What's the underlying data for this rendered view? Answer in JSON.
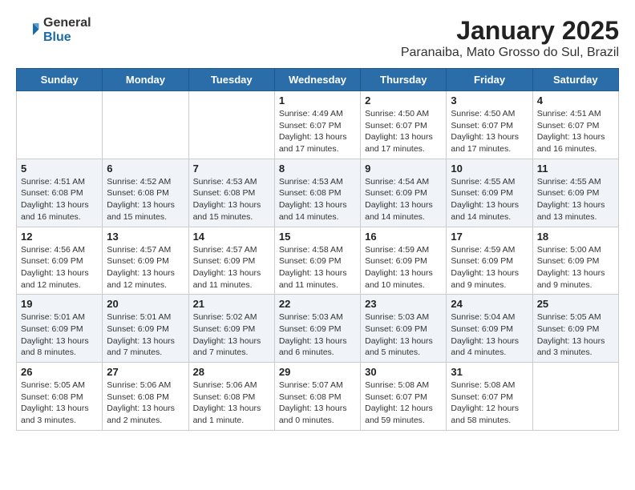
{
  "header": {
    "logo_general": "General",
    "logo_blue": "Blue",
    "title": "January 2025",
    "location": "Paranaiba, Mato Grosso do Sul, Brazil"
  },
  "days_of_week": [
    "Sunday",
    "Monday",
    "Tuesday",
    "Wednesday",
    "Thursday",
    "Friday",
    "Saturday"
  ],
  "weeks": [
    [
      {
        "day": "",
        "info": ""
      },
      {
        "day": "",
        "info": ""
      },
      {
        "day": "",
        "info": ""
      },
      {
        "day": "1",
        "info": "Sunrise: 4:49 AM\nSunset: 6:07 PM\nDaylight: 13 hours\nand 17 minutes."
      },
      {
        "day": "2",
        "info": "Sunrise: 4:50 AM\nSunset: 6:07 PM\nDaylight: 13 hours\nand 17 minutes."
      },
      {
        "day": "3",
        "info": "Sunrise: 4:50 AM\nSunset: 6:07 PM\nDaylight: 13 hours\nand 17 minutes."
      },
      {
        "day": "4",
        "info": "Sunrise: 4:51 AM\nSunset: 6:07 PM\nDaylight: 13 hours\nand 16 minutes."
      }
    ],
    [
      {
        "day": "5",
        "info": "Sunrise: 4:51 AM\nSunset: 6:08 PM\nDaylight: 13 hours\nand 16 minutes."
      },
      {
        "day": "6",
        "info": "Sunrise: 4:52 AM\nSunset: 6:08 PM\nDaylight: 13 hours\nand 15 minutes."
      },
      {
        "day": "7",
        "info": "Sunrise: 4:53 AM\nSunset: 6:08 PM\nDaylight: 13 hours\nand 15 minutes."
      },
      {
        "day": "8",
        "info": "Sunrise: 4:53 AM\nSunset: 6:08 PM\nDaylight: 13 hours\nand 14 minutes."
      },
      {
        "day": "9",
        "info": "Sunrise: 4:54 AM\nSunset: 6:09 PM\nDaylight: 13 hours\nand 14 minutes."
      },
      {
        "day": "10",
        "info": "Sunrise: 4:55 AM\nSunset: 6:09 PM\nDaylight: 13 hours\nand 14 minutes."
      },
      {
        "day": "11",
        "info": "Sunrise: 4:55 AM\nSunset: 6:09 PM\nDaylight: 13 hours\nand 13 minutes."
      }
    ],
    [
      {
        "day": "12",
        "info": "Sunrise: 4:56 AM\nSunset: 6:09 PM\nDaylight: 13 hours\nand 12 minutes."
      },
      {
        "day": "13",
        "info": "Sunrise: 4:57 AM\nSunset: 6:09 PM\nDaylight: 13 hours\nand 12 minutes."
      },
      {
        "day": "14",
        "info": "Sunrise: 4:57 AM\nSunset: 6:09 PM\nDaylight: 13 hours\nand 11 minutes."
      },
      {
        "day": "15",
        "info": "Sunrise: 4:58 AM\nSunset: 6:09 PM\nDaylight: 13 hours\nand 11 minutes."
      },
      {
        "day": "16",
        "info": "Sunrise: 4:59 AM\nSunset: 6:09 PM\nDaylight: 13 hours\nand 10 minutes."
      },
      {
        "day": "17",
        "info": "Sunrise: 4:59 AM\nSunset: 6:09 PM\nDaylight: 13 hours\nand 9 minutes."
      },
      {
        "day": "18",
        "info": "Sunrise: 5:00 AM\nSunset: 6:09 PM\nDaylight: 13 hours\nand 9 minutes."
      }
    ],
    [
      {
        "day": "19",
        "info": "Sunrise: 5:01 AM\nSunset: 6:09 PM\nDaylight: 13 hours\nand 8 minutes."
      },
      {
        "day": "20",
        "info": "Sunrise: 5:01 AM\nSunset: 6:09 PM\nDaylight: 13 hours\nand 7 minutes."
      },
      {
        "day": "21",
        "info": "Sunrise: 5:02 AM\nSunset: 6:09 PM\nDaylight: 13 hours\nand 7 minutes."
      },
      {
        "day": "22",
        "info": "Sunrise: 5:03 AM\nSunset: 6:09 PM\nDaylight: 13 hours\nand 6 minutes."
      },
      {
        "day": "23",
        "info": "Sunrise: 5:03 AM\nSunset: 6:09 PM\nDaylight: 13 hours\nand 5 minutes."
      },
      {
        "day": "24",
        "info": "Sunrise: 5:04 AM\nSunset: 6:09 PM\nDaylight: 13 hours\nand 4 minutes."
      },
      {
        "day": "25",
        "info": "Sunrise: 5:05 AM\nSunset: 6:09 PM\nDaylight: 13 hours\nand 3 minutes."
      }
    ],
    [
      {
        "day": "26",
        "info": "Sunrise: 5:05 AM\nSunset: 6:08 PM\nDaylight: 13 hours\nand 3 minutes."
      },
      {
        "day": "27",
        "info": "Sunrise: 5:06 AM\nSunset: 6:08 PM\nDaylight: 13 hours\nand 2 minutes."
      },
      {
        "day": "28",
        "info": "Sunrise: 5:06 AM\nSunset: 6:08 PM\nDaylight: 13 hours\nand 1 minute."
      },
      {
        "day": "29",
        "info": "Sunrise: 5:07 AM\nSunset: 6:08 PM\nDaylight: 13 hours\nand 0 minutes."
      },
      {
        "day": "30",
        "info": "Sunrise: 5:08 AM\nSunset: 6:07 PM\nDaylight: 12 hours\nand 59 minutes."
      },
      {
        "day": "31",
        "info": "Sunrise: 5:08 AM\nSunset: 6:07 PM\nDaylight: 12 hours\nand 58 minutes."
      },
      {
        "day": "",
        "info": ""
      }
    ]
  ]
}
